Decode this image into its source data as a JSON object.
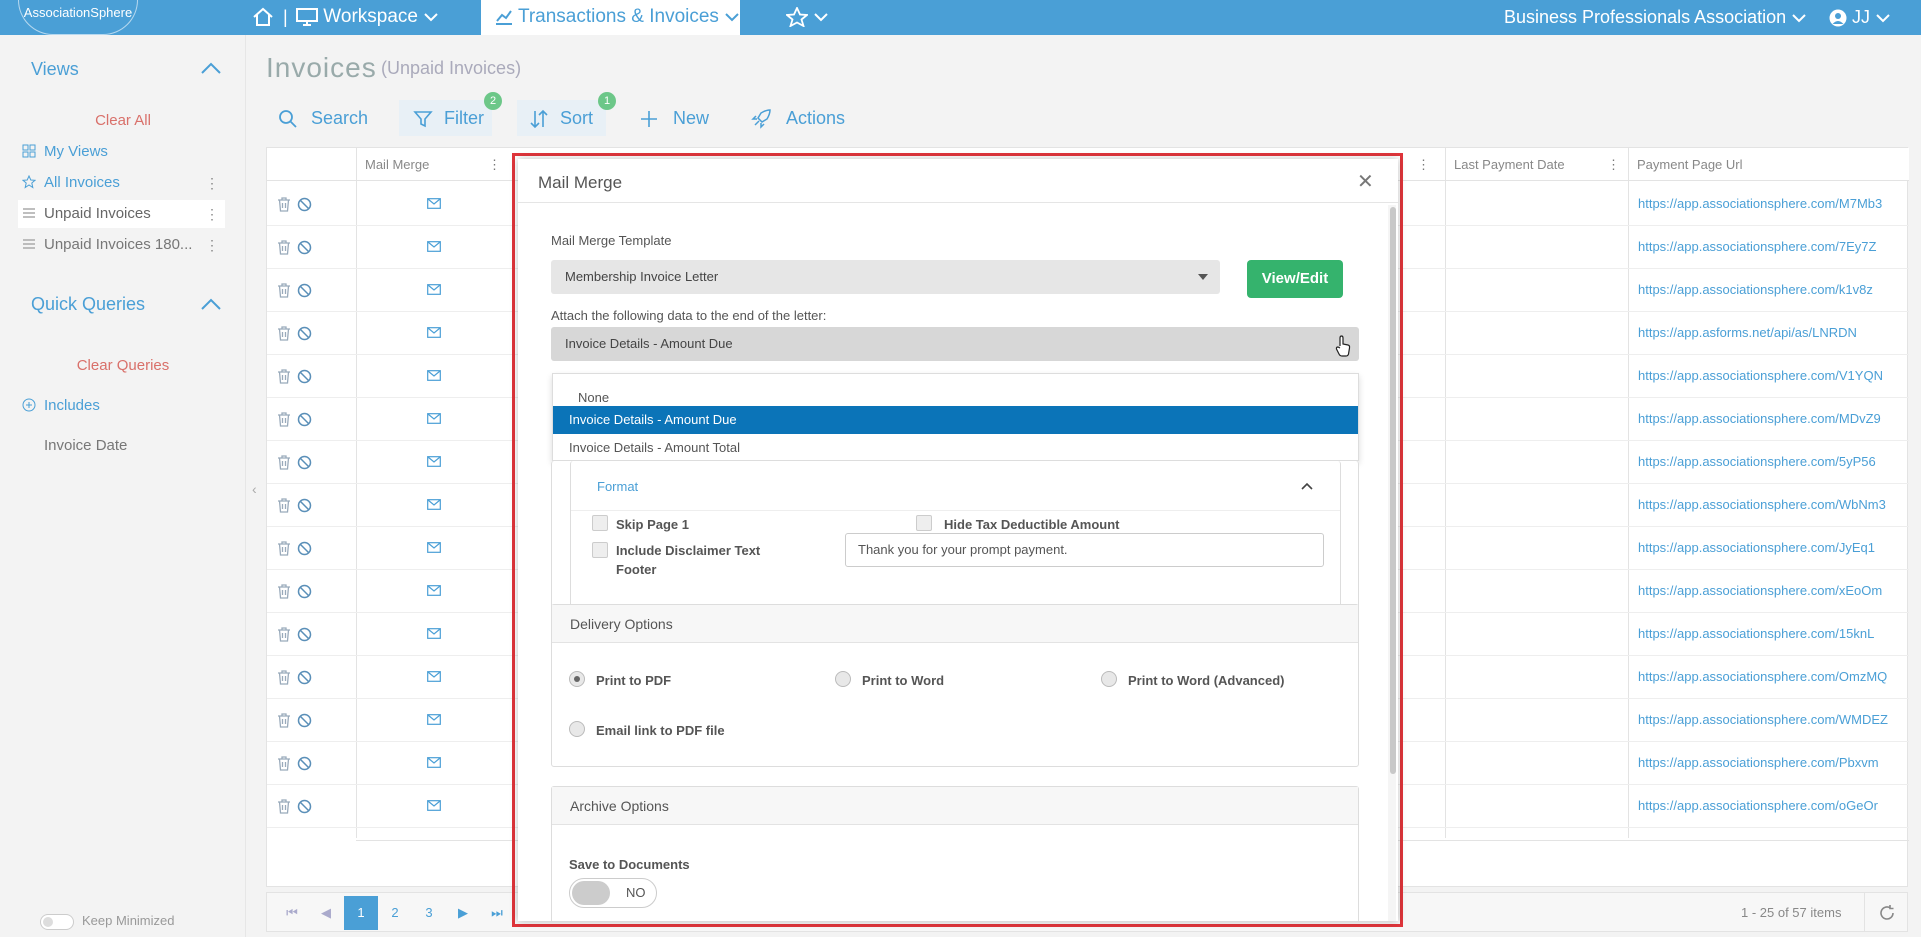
{
  "topbar": {
    "logo": "AssociationSphere",
    "workspace": "Workspace",
    "transactions": "Transactions & Invoices",
    "org": "Business Professionals Association",
    "user": "JJ"
  },
  "sidebar": {
    "views_title": "Views",
    "clear_all": "Clear All",
    "items": [
      {
        "label": "My Views"
      },
      {
        "label": "All Invoices"
      },
      {
        "label": "Unpaid Invoices"
      },
      {
        "label": "Unpaid Invoices 180..."
      }
    ],
    "quick_title": "Quick Queries",
    "clear_queries": "Clear Queries",
    "includes": "Includes",
    "invoice_date": "Invoice Date",
    "keep_minimized": "Keep Minimized"
  },
  "page": {
    "title": "Invoices",
    "subtitle": "(Unpaid Invoices)"
  },
  "toolbar": {
    "search": "Search",
    "filter": "Filter",
    "filter_count": "2",
    "sort": "Sort",
    "sort_count": "1",
    "new": "New",
    "actions": "Actions"
  },
  "grid": {
    "columns": [
      "Mail Merge",
      "Last Payment Date",
      "Payment Page Url"
    ],
    "urls": [
      "https://app.associationsphere.com/M7Mb3",
      "https://app.associationsphere.com/7Ey7Z",
      "https://app.associationsphere.com/k1v8z",
      "https://app.asforms.net/api/as/LNRDN",
      "https://app.associationsphere.com/V1YQN",
      "https://app.associationsphere.com/MDvZ9",
      "https://app.associationsphere.com/5yP56",
      "https://app.associationsphere.com/WbNm3",
      "https://app.associationsphere.com/JyEq1",
      "https://app.associationsphere.com/xEoOm",
      "https://app.associationsphere.com/15knL",
      "https://app.associationsphere.com/OmzMQ",
      "https://app.associationsphere.com/WMDEZ",
      "https://app.associationsphere.com/Pbxvm",
      "https://app.associationsphere.com/oGeOr"
    ]
  },
  "pager": {
    "pages": [
      "1",
      "2",
      "3"
    ],
    "info": "1 - 25 of 57 items"
  },
  "modal": {
    "title": "Mail Merge",
    "template_label": "Mail Merge Template",
    "template_value": "Membership Invoice Letter",
    "view_edit": "View/Edit",
    "attach_label": "Attach the following data to the end of the letter:",
    "attach_value": "Invoice Details - Amount Due",
    "options": [
      "None",
      "Invoice Details - Amount Due",
      "Invoice Details - Amount Total"
    ],
    "format_title": "Format",
    "skip_page": "Skip Page 1",
    "hide_tax": "Hide Tax Deductible Amount",
    "disclaimer_1": "Include Disclaimer Text",
    "disclaimer_2": "Footer",
    "disclaimer_value": "Thank you for your prompt payment.",
    "delivery_title": "Delivery Options",
    "print_pdf": "Print to PDF",
    "print_word": "Print to Word",
    "print_word_adv": "Print to Word (Advanced)",
    "email_link": "Email link to PDF file",
    "archive_title": "Archive Options",
    "save_docs": "Save to Documents",
    "save_toggle": "NO"
  },
  "colors": {
    "accent": "#4a9fd6",
    "green": "#35b36d",
    "highlight": "#0b74b8",
    "frame": "#e0353b"
  }
}
